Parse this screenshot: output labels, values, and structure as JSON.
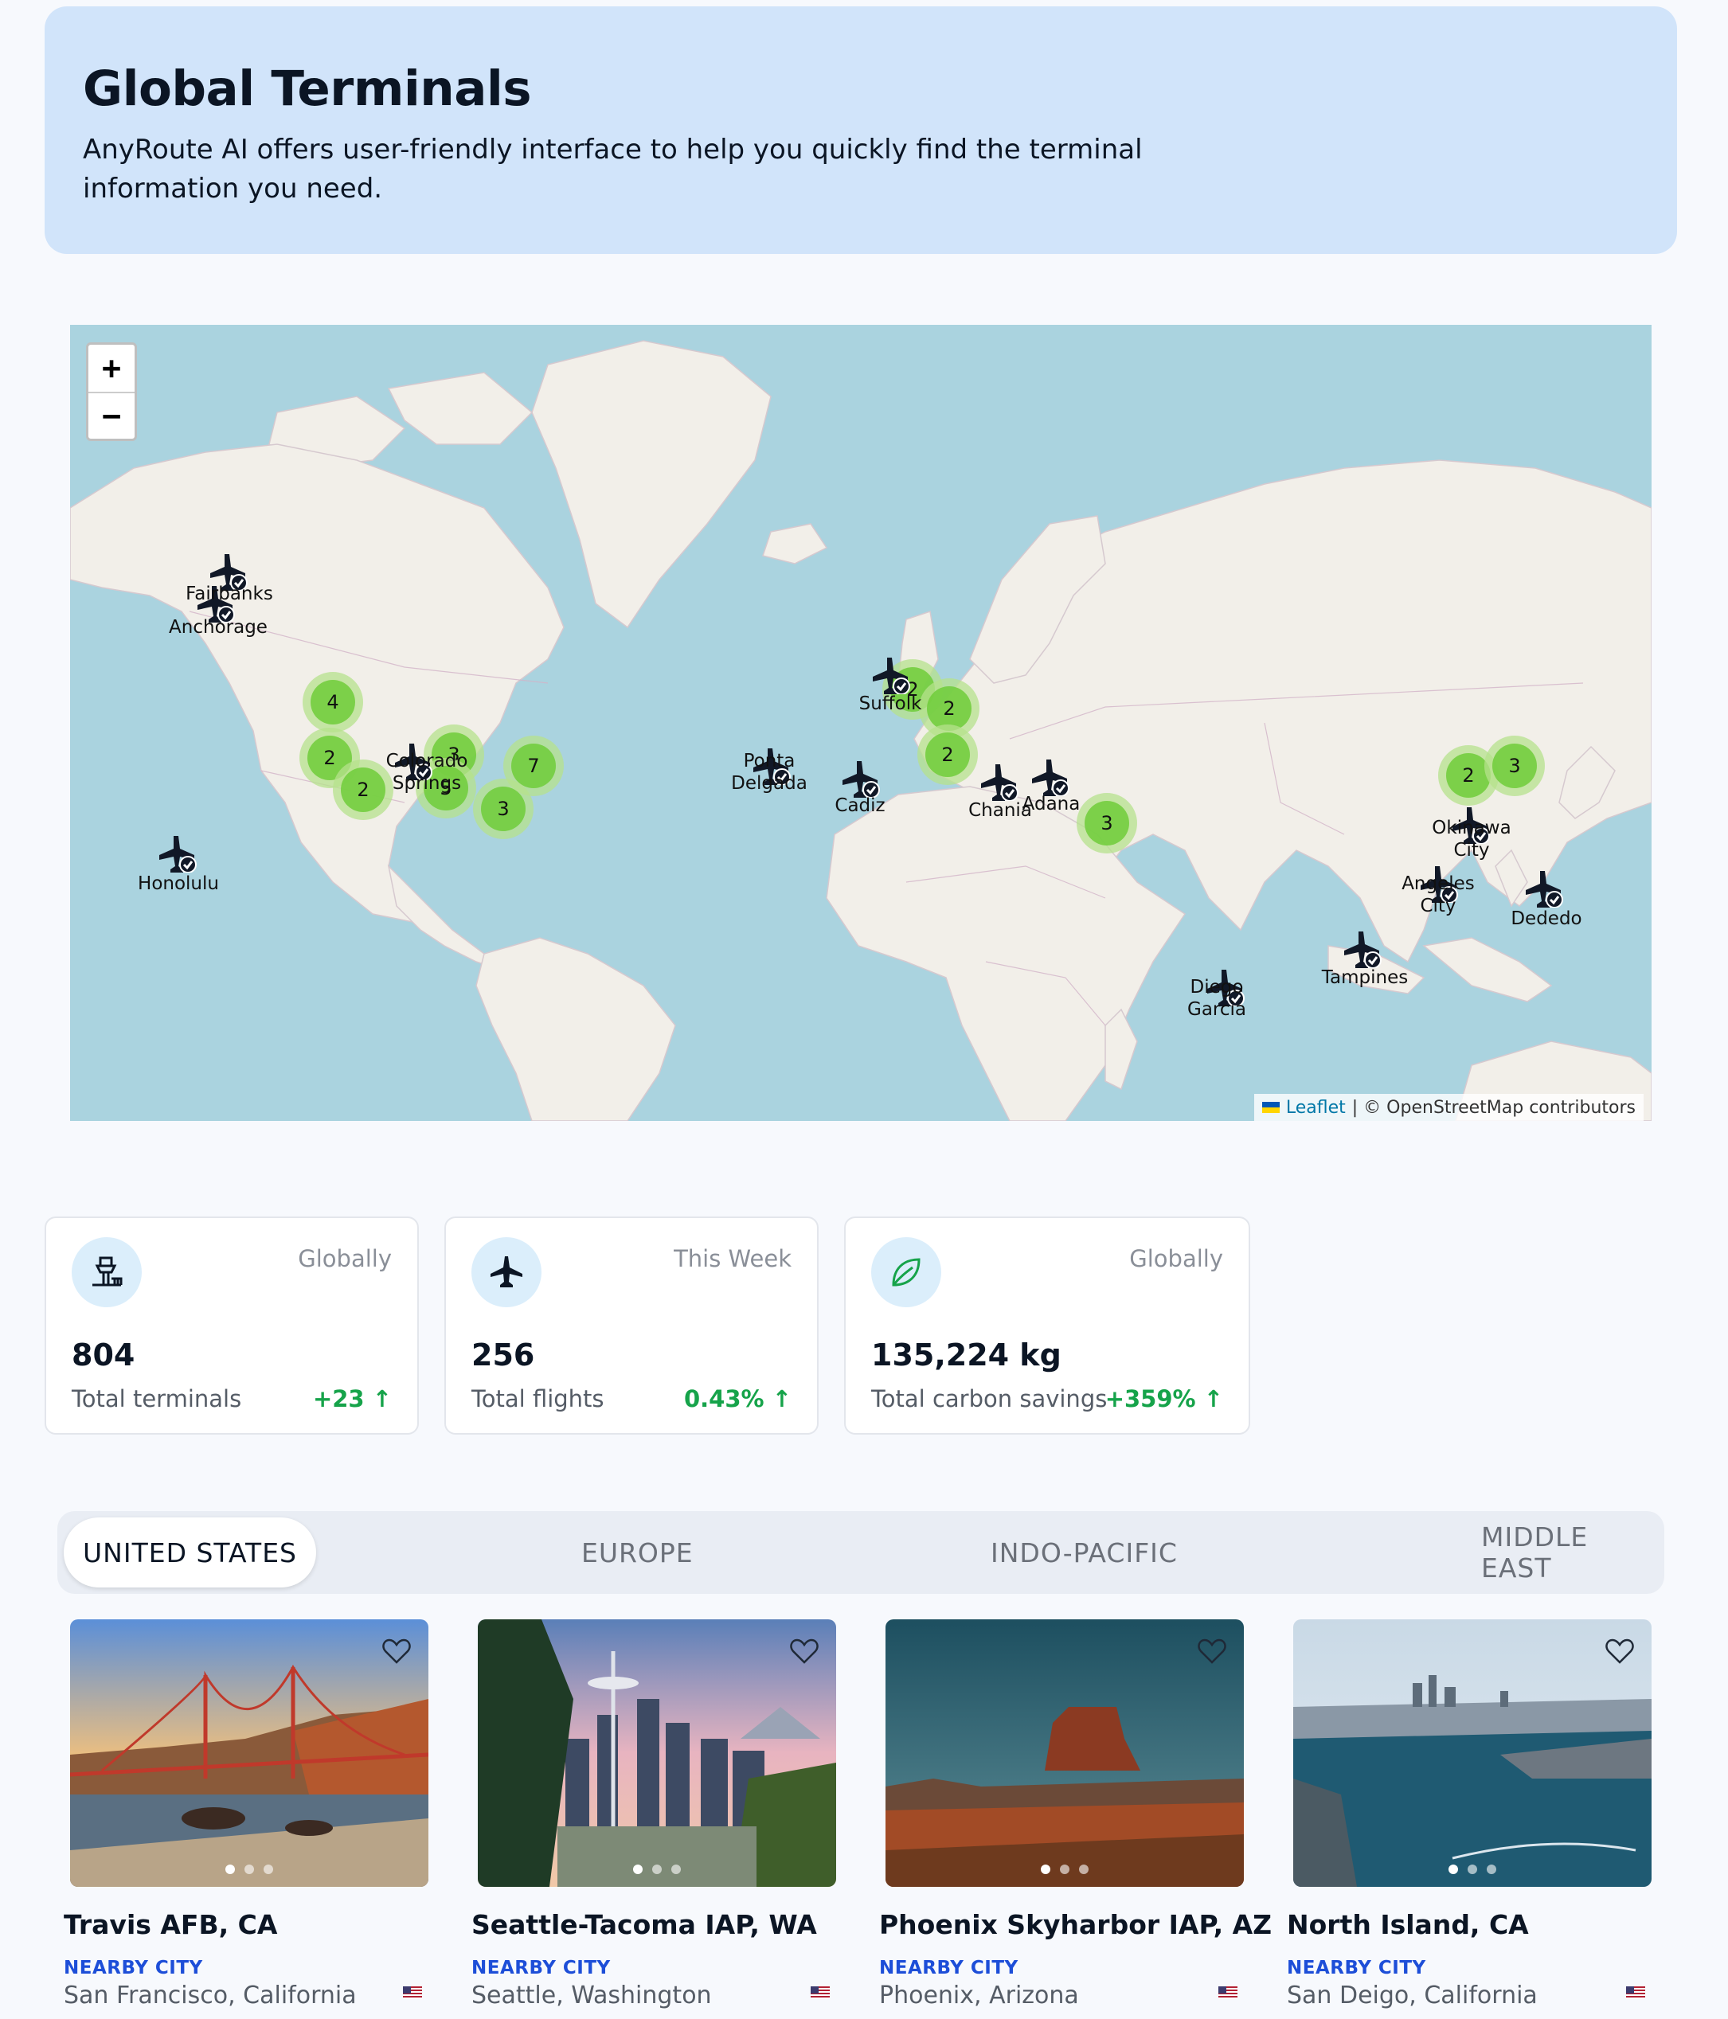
{
  "hero": {
    "title": "Global Terminals",
    "subtitle": "AnyRoute AI offers user-friendly interface to help you quickly find the terminal information you need."
  },
  "map": {
    "zoom_in": "+",
    "zoom_out": "−",
    "attribution_leaflet": "Leaflet",
    "attribution_rest": "| © OpenStreetMap contributors",
    "clusters": [
      "4",
      "2",
      "2",
      "3",
      "5",
      "3",
      "7",
      "2",
      "2",
      "2",
      "3",
      "2",
      "3"
    ],
    "places": [
      "Fairbanks",
      "Anchorage",
      "Colorado Springs",
      "Honolulu",
      "Ponta Delgada",
      "Cadiz",
      "Suffolk",
      "Chania",
      "Adana",
      "Okinawa City",
      "Angeles City",
      "Dededo",
      "Tampines",
      "Diego Garcia"
    ]
  },
  "stats": [
    {
      "icon": "control-tower-icon",
      "scope": "Globally",
      "value": "804",
      "label": "Total terminals",
      "change": "+23 ↑"
    },
    {
      "icon": "airplane-icon",
      "scope": "This Week",
      "value": "256",
      "label": "Total flights",
      "change": "0.43% ↑"
    },
    {
      "icon": "leaf-icon",
      "scope": "Globally",
      "value": "135,224 kg",
      "label": "Total carbon savings",
      "change": "+359% ↑"
    }
  ],
  "tabs": [
    "UNITED STATES",
    "EUROPE",
    "INDO-PACIFIC",
    "MIDDLE EAST"
  ],
  "active_tab": "UNITED STATES",
  "cards": [
    {
      "title": "Travis AFB, CA",
      "nearby_label": "NEARBY CITY",
      "city": "San Francisco, California"
    },
    {
      "title": "Seattle-Tacoma IAP, WA",
      "nearby_label": "NEARBY CITY",
      "city": "Seattle, Washington"
    },
    {
      "title": "Phoenix Skyharbor IAP, AZ",
      "nearby_label": "NEARBY CITY",
      "city": "Phoenix, Arizona"
    },
    {
      "title": "North Island, CA",
      "nearby_label": "NEARBY CITY",
      "city": "San Deigo, California"
    }
  ],
  "colors": {
    "hero_bg": "#d1e4fa",
    "ocean": "#aad3df",
    "land": "#f2efe9",
    "cluster": "#6ecc39",
    "positive": "#16a34a",
    "nearby": "#1d4ed8"
  }
}
